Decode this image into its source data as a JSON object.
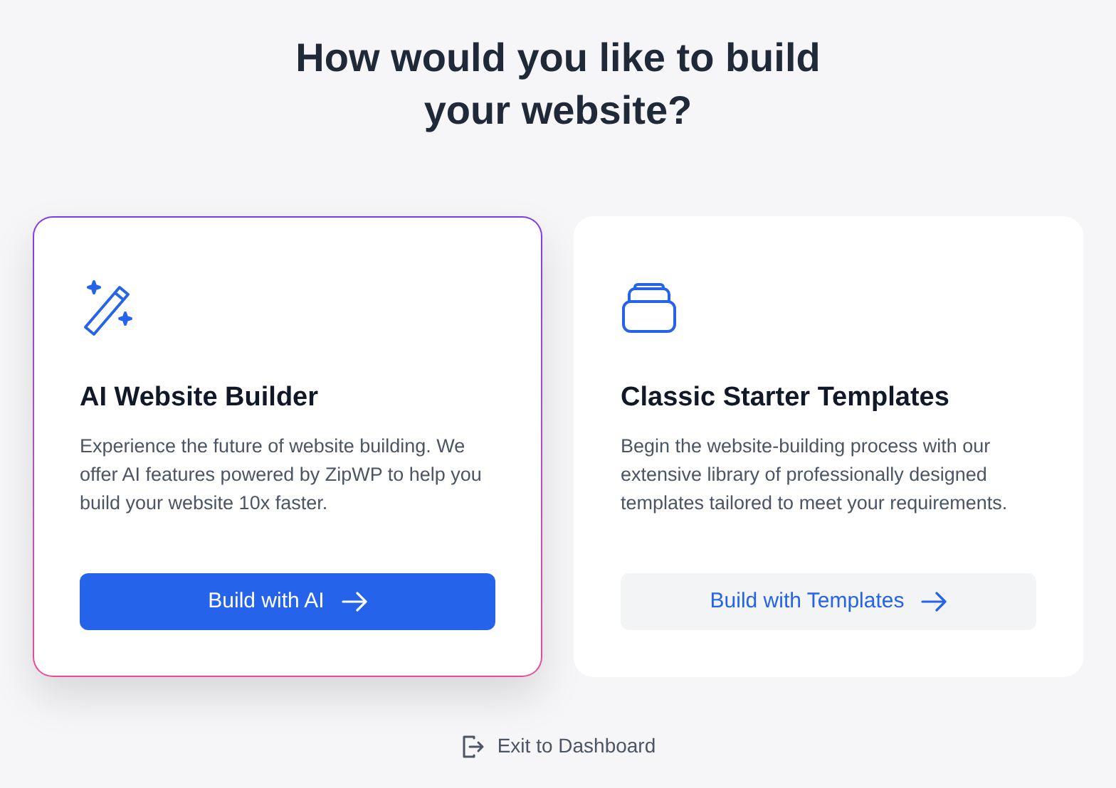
{
  "heading": "How would you like to build your website?",
  "options": [
    {
      "kind": "ai",
      "selected": true,
      "title": "AI Website Builder",
      "description": "Experience the future of website building. We offer AI features powered by ZipWP to help you build your website 10x faster.",
      "button": {
        "label": "Build with AI",
        "kind": "primary"
      }
    },
    {
      "kind": "templates",
      "selected": false,
      "title": "Classic Starter Templates",
      "description": "Begin the website-building process with our extensive library of professionally designed templates tailored to meet your requirements.",
      "button": {
        "label": "Build with Templates",
        "kind": "secondary"
      }
    }
  ],
  "exit_link": "Exit to Dashboard"
}
